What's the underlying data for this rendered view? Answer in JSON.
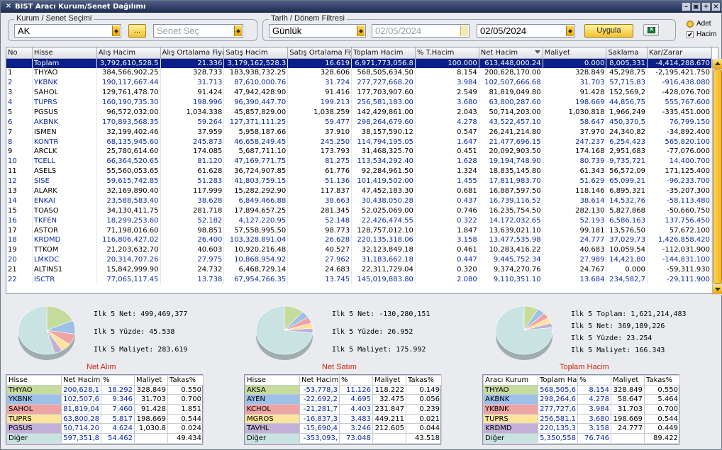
{
  "window": {
    "title": "BIST Aracı Kurum/Senet Dağılımı",
    "close_glyph": "×",
    "buttons": [
      "–",
      "▣",
      "+",
      "×"
    ]
  },
  "filters": {
    "kurum_group": "Kurum / Senet Seçimi",
    "kurum_value": "AK",
    "dots_label": "...",
    "senet_placeholder": "Senet Seç",
    "date_group": "Tarih / Dönem Filtresi",
    "period_value": "Günlük",
    "date_from": "02/05/2024",
    "date_to": "02/05/2024",
    "apply_label": "Uygula",
    "option_adet": "Adet",
    "option_hacim": "Hacim",
    "hacim_checked": "✔"
  },
  "grid": {
    "columns": [
      "No",
      "Hisse",
      "Alış Hacim",
      "Alış Ortalama Fiya",
      "Satış Hacim",
      "Satış Ortalama Fiy",
      "Toplam Hacim",
      "% T.Hacim",
      "Net Hacim",
      "Maliyet",
      "Saklama",
      "Kar/Zarar"
    ],
    "total": [
      "",
      "Toplam",
      "3,792,610,528.5",
      "21.336",
      "3,179,162,528.3",
      "16.619",
      "6,971,773,056.8",
      "100.000",
      "613,448,000.24",
      "0.000",
      "8,005,331",
      "-4,414,288.670"
    ],
    "rows": [
      [
        "1",
        "THYAO",
        "384,566,902.25",
        "328.733",
        "183,938,732.25",
        "328.606",
        "568,505,634.50",
        "8.154",
        "200,628,170.00",
        "328.849",
        "45,298,75",
        "-2,195,421.750"
      ],
      [
        "2",
        "YKBNK",
        "190,117,667.44",
        "31.713",
        "87,610,000.76",
        "31.724",
        "277,727,668.20",
        "3.984",
        "102,507,666.68",
        "31.703",
        "57,715,83",
        "-916,438.080"
      ],
      [
        "3",
        "SAHOL",
        "129,761,478.70",
        "91.424",
        "47,942,428.90",
        "91.416",
        "177,703,907.60",
        "2.549",
        "81,819,049.80",
        "91.428",
        "152,569,2",
        "-428,076.700"
      ],
      [
        "4",
        "TUPRS",
        "160,190,735.30",
        "198.996",
        "96,390,447.70",
        "199.213",
        "256,581,183.00",
        "3.680",
        "63,800,287.60",
        "198.669",
        "44,856,75",
        "555,767.600"
      ],
      [
        "5",
        "PGSUS",
        "96,572,032.00",
        "1,034.338",
        "45,857,829.00",
        "1,038.259",
        "142,429,861.00",
        "2.043",
        "50,714,203.00",
        "1,030.818",
        "1,966,249",
        "-335,451.000"
      ],
      [
        "6",
        "AKBNK",
        "170,893,568.35",
        "59.264",
        "127,371,111.25",
        "59.477",
        "298,264,679.60",
        "4.278",
        "43,522,457.10",
        "58.647",
        "450,370,5",
        "76,799.150"
      ],
      [
        "7",
        "ISMEN",
        "32,199,402.46",
        "37.959",
        "5,958,187.66",
        "37.910",
        "38,157,590.12",
        "0.547",
        "26,241,214.80",
        "37.970",
        "24,340,82",
        "-34,892.400"
      ],
      [
        "8",
        "KONTR",
        "68,135,945.60",
        "245.873",
        "46,658,249.45",
        "245.250",
        "114,794,195.05",
        "1.647",
        "21,477,696.15",
        "247.237",
        "6,254,423",
        "565,820.100"
      ],
      [
        "9",
        "ARCLK",
        "25,780,614.60",
        "174.085",
        "5,687,711.10",
        "173.793",
        "31,468,325.70",
        "0.451",
        "20,092,903.50",
        "174.168",
        "2,951,683",
        "-77,076.000"
      ],
      [
        "10",
        "TCELL",
        "66,364,520.65",
        "81.120",
        "47,169,771.75",
        "81.275",
        "113,534,292.40",
        "1.628",
        "19,194,748.90",
        "80.739",
        "9,735,721",
        "14,400.700"
      ],
      [
        "11",
        "ASELS",
        "55,560,053.65",
        "61.628",
        "36,724,907.85",
        "61.776",
        "92,284,961.50",
        "1.324",
        "18,835,145.80",
        "61.343",
        "56,572,09",
        "171,125.400"
      ],
      [
        "12",
        "SISE",
        "59,615,742.85",
        "51.283",
        "41,803,759.15",
        "51.136",
        "101,419,502.00",
        "1.455",
        "17,811,983.70",
        "51.629",
        "65,099,21",
        "-96,233.700"
      ],
      [
        "13",
        "ALARK",
        "32,169,890.40",
        "117.999",
        "15,282,292.90",
        "117.837",
        "47,452,183.30",
        "0.681",
        "16,887,597.50",
        "118.146",
        "6,895,321",
        "-35,207.300"
      ],
      [
        "14",
        "ENKAI",
        "23,588,583.40",
        "38.628",
        "6,849,466.88",
        "38.663",
        "30,438,050.28",
        "0.437",
        "16,739,116.52",
        "38.614",
        "14,532,76",
        "-58,113.480"
      ],
      [
        "15",
        "TOASO",
        "34,130,411.75",
        "281.718",
        "17,894,657.25",
        "281.345",
        "52,025,069.00",
        "0.746",
        "16,235,754.50",
        "282.130",
        "5,827,868",
        "-50,660.750"
      ],
      [
        "16",
        "TKFEN",
        "18,299,253.60",
        "52.182",
        "4,127,220.95",
        "52.148",
        "22,426,474.55",
        "0.322",
        "14,172,032.65",
        "52.193",
        "6,586,163",
        "137,756.450"
      ],
      [
        "17",
        "ASTOR",
        "71,198,016.60",
        "98.851",
        "57,558,995.50",
        "98.773",
        "128,757,012.10",
        "1.847",
        "13,639,021.10",
        "99.181",
        "13,576,50",
        "57,672.100"
      ],
      [
        "18",
        "KRDMD",
        "116,806,427.02",
        "26.400",
        "103,328,891.04",
        "26.628",
        "220,135,318.06",
        "3.158",
        "13,477,535.98",
        "24.777",
        "37,029,73",
        "1,426,858.420"
      ],
      [
        "19",
        "TTKOM",
        "21,203,632.70",
        "40.603",
        "10,920,216.48",
        "40.527",
        "32,123,849.18",
        "0.461",
        "10,283,416.22",
        "40.683",
        "10,059,54",
        "-112,031.900"
      ],
      [
        "20",
        "LMKDC",
        "20,314,707.26",
        "27.975",
        "10,868,954.92",
        "27.962",
        "31,183,662.18",
        "0.447",
        "9,445,752.34",
        "27.989",
        "14,421,80",
        "-144,831.100"
      ],
      [
        "21",
        "ALTINS1",
        "15,842,999.90",
        "24.732",
        "6,468,729.14",
        "24.683",
        "22,311,729.04",
        "0.320",
        "9,374,270.76",
        "24.767",
        "0.000",
        "-59,311.930"
      ],
      [
        "22",
        "ISCTR",
        "77,065,117.45",
        "13.738",
        "67,954,766.35",
        "13.745",
        "145,019,883.80",
        "2.080",
        "9,110,351.10",
        "13.684",
        "234,582,7",
        "-29,111.900"
      ]
    ]
  },
  "panels": [
    {
      "title": "Net Alım",
      "info": [
        "Ilk 5 Net: 499,469,377",
        "Ilk 5 Yüzde: 45.538",
        "Ilk 5 Maliyet: 283.619"
      ],
      "headers": [
        "Hisse",
        "Net Hacim",
        "%",
        "Maliyet",
        "Takas%"
      ],
      "rows": [
        {
          "c": [
            "THYAO",
            "200,628,1",
            "18.292",
            "328.849",
            "0.550"
          ],
          "color": "#c6dc9c"
        },
        {
          "c": [
            "YKBNK",
            "102,507,6",
            "9.346",
            "31.703",
            "0.700"
          ],
          "color": "#9cc0e8"
        },
        {
          "c": [
            "SAHOL",
            "81,819,04",
            "7.460",
            "91.428",
            "1.851"
          ],
          "color": "#efa4a4"
        },
        {
          "c": [
            "TUPRS",
            "63,800,28",
            "5.817",
            "198.669",
            "0.544"
          ],
          "color": "#fde39c"
        },
        {
          "c": [
            "PGSUS",
            "50,714,20",
            "4.624",
            "1,030.8",
            "0.024"
          ],
          "color": "#c2b0d8"
        },
        {
          "c": [
            "Diğer",
            "597,351,8",
            "54.462",
            "",
            "49.434"
          ],
          "color": "#c9e3e2"
        }
      ],
      "pie": [
        18.292,
        9.346,
        7.46,
        5.817,
        4.624,
        54.462
      ]
    },
    {
      "title": "Net Satım",
      "info": [
        "Ilk 5 Net: -130,280,151",
        "Ilk 5 Yüzde: 26.952",
        "Ilk 5 Maliyet: 175.992"
      ],
      "headers": [
        "Hisse",
        "Net Hacim",
        "%",
        "Maliyet",
        "Takas%"
      ],
      "rows": [
        {
          "c": [
            "AKSA",
            "-53,778,3",
            "11.126",
            "118.222",
            "0.149"
          ],
          "color": "#c6dc9c"
        },
        {
          "c": [
            "AYEN",
            "-22,692,2",
            "4.695",
            "32.475",
            "0.056"
          ],
          "color": "#9cc0e8"
        },
        {
          "c": [
            "KCHOL",
            "-21,281,7",
            "4.403",
            "231.847",
            "0.239"
          ],
          "color": "#efa4a4"
        },
        {
          "c": [
            "MGROS",
            "-16,837,3",
            "3.483",
            "449.211",
            "0.021"
          ],
          "color": "#fde39c"
        },
        {
          "c": [
            "TAVHL",
            "-15,690,4",
            "3.246",
            "212.605",
            "0.044"
          ],
          "color": "#c2b0d8"
        },
        {
          "c": [
            "Diğer",
            "-353,093,",
            "73.048",
            "",
            "43.518"
          ],
          "color": "#c9e3e2"
        }
      ],
      "pie": [
        11.126,
        4.695,
        4.403,
        3.483,
        3.246,
        73.048
      ]
    },
    {
      "title": "Toplam Hacim",
      "info": [
        "Ilk 5 Toplam: 1,621,214,483",
        "Ilk 5 Net: 369,189,226",
        "Ilk 5 Yüzde: 23.254",
        "Ilk 5 Maliyet: 166.343"
      ],
      "headers": [
        "Aracı Kurum",
        "Toplam Ha",
        "%",
        "Maliyet",
        "Takas%"
      ],
      "rows": [
        {
          "c": [
            "THYAO",
            "568,505,6",
            "8.154",
            "328.849",
            "0.550"
          ],
          "color": "#c6dc9c"
        },
        {
          "c": [
            "AKBNK",
            "298,264,6",
            "4.278",
            "58.647",
            "5.464"
          ],
          "color": "#9cc0e8"
        },
        {
          "c": [
            "YKBNK",
            "277,727,6",
            "3.984",
            "31.703",
            "0.700"
          ],
          "color": "#efa4a4"
        },
        {
          "c": [
            "TUPRS",
            "256,581,1",
            "3.680",
            "198.669",
            "0.544"
          ],
          "color": "#fde39c"
        },
        {
          "c": [
            "KRDMD",
            "220,135,3",
            "3.158",
            "24.777",
            "0.449"
          ],
          "color": "#c2b0d8"
        },
        {
          "c": [
            "Diğer",
            "5,350,558",
            "76.746",
            "",
            "89.422"
          ],
          "color": "#c9e3e2"
        }
      ],
      "pie": [
        8.154,
        4.278,
        3.984,
        3.68,
        3.158,
        76.746
      ]
    }
  ]
}
